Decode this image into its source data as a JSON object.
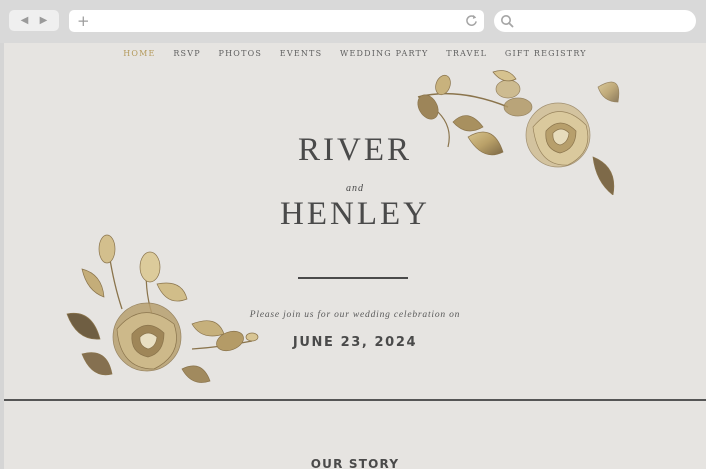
{
  "browser": {
    "back_icon": "back-arrow-icon",
    "forward_icon": "forward-arrow-icon",
    "url_value": "",
    "search_value": ""
  },
  "nav": {
    "items": [
      "HOME",
      "RSVP",
      "PHOTOS",
      "EVENTS",
      "WEDDING PARTY",
      "TRAVEL",
      "GIFT REGISTRY"
    ],
    "active": "HOME"
  },
  "hero": {
    "name1": "RIVER",
    "and": "and",
    "name2": "HENLEY",
    "invite": "Please join us for our wedding celebration on",
    "date": "JUNE 23, 2024"
  },
  "sections": {
    "story_title": "OUR STORY"
  },
  "colors": {
    "background": "#e6e4e1",
    "text": "#4a4a4a",
    "accent_gold": "#b49a5c"
  }
}
